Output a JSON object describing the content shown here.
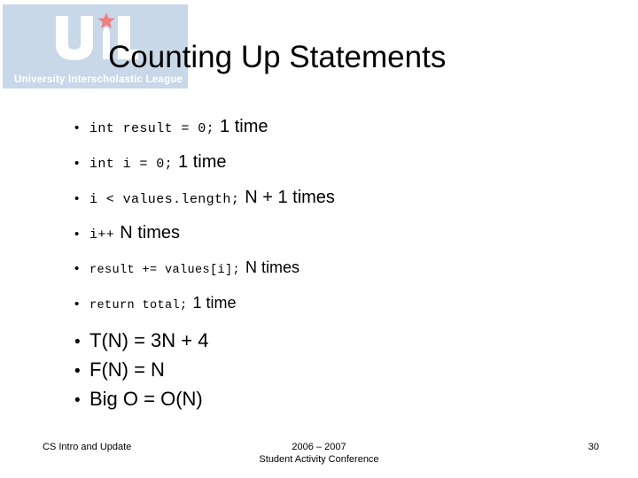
{
  "logo": {
    "wordmark": "UIL",
    "caption": "University Interscholastic League",
    "background_color": "#c9d8e8",
    "star_color": "#ef8080",
    "letter_color": "#ffffff"
  },
  "slide": {
    "title": "Counting Up Statements",
    "bullets": [
      {
        "code": "int result = 0;",
        "note": "1 time",
        "style": "code"
      },
      {
        "code": "int i = 0;",
        "note": "1 time",
        "style": "code"
      },
      {
        "code": "i < values.length;",
        "note": "N + 1 times",
        "style": "code"
      },
      {
        "code": "i++",
        "note": "N times",
        "style": "code"
      },
      {
        "code": "result += values[i];",
        "note": "N times",
        "style": "code-small"
      },
      {
        "code": "return total;",
        "note": "1 time",
        "style": "code-small"
      },
      {
        "code": "",
        "note": "T(N) = 3N + 4",
        "style": "plain"
      },
      {
        "code": "",
        "note": "F(N) = N",
        "style": "plain"
      },
      {
        "code": "",
        "note": "Big O = O(N)",
        "style": "plain"
      }
    ],
    "bullet_glyph": "•"
  },
  "footer": {
    "left": "CS Intro and Update",
    "center": "2006 – 2007\nStudent Activity Conference",
    "page_number": "30"
  }
}
